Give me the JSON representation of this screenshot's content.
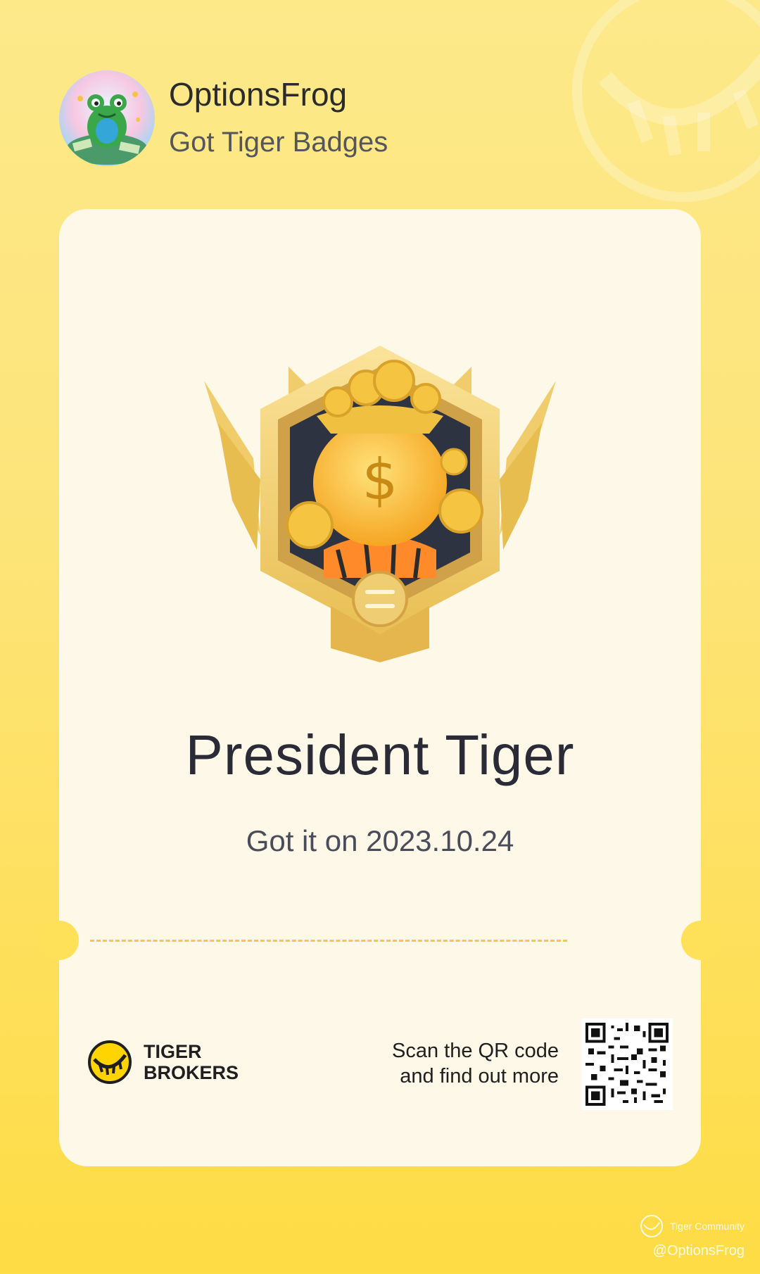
{
  "header": {
    "username": "OptionsFrog",
    "subtitle": "Got Tiger Badges",
    "avatar_icon": "frog-avatar"
  },
  "badge": {
    "icon": "money-bag-tiger-badge",
    "title": "President Tiger",
    "date_text": "Got it on 2023.10.24"
  },
  "footer": {
    "brand_line1": "TIGER",
    "brand_line2": "BROKERS",
    "scan_line1": "Scan the QR code",
    "scan_line2": "and find out more"
  },
  "watermark": {
    "line1": "Tiger Community",
    "line2": "@OptionsFrog"
  },
  "colors": {
    "background_top": "#fde98a",
    "background_bottom": "#fedc45",
    "card": "#fdf8e8",
    "dash": "#f2c94c",
    "gold": "#f2c94c"
  }
}
